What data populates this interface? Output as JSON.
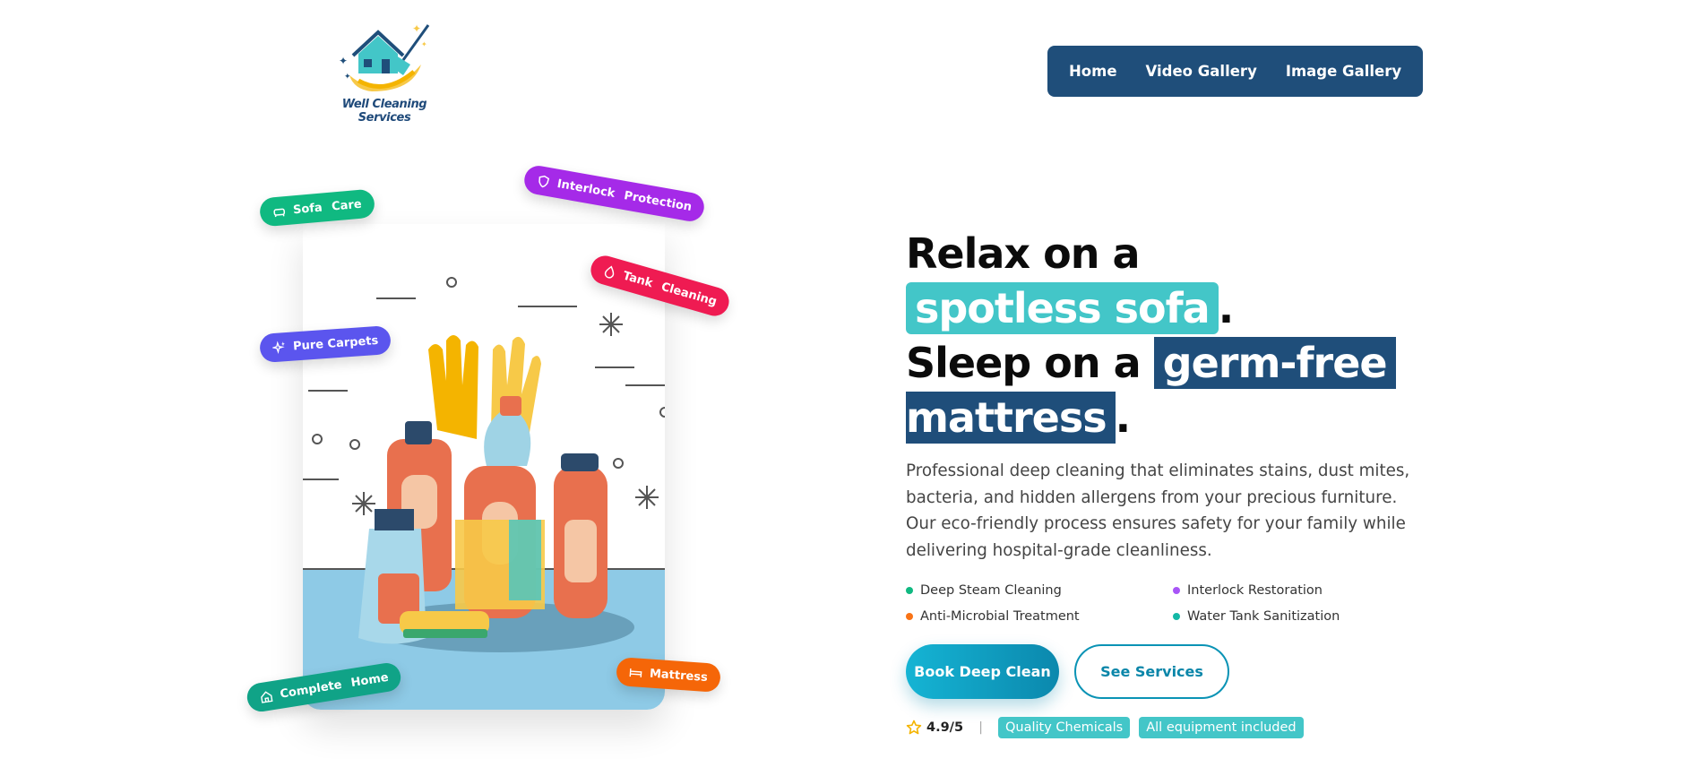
{
  "brand": {
    "name": "Well Cleaning Services",
    "logo_icon": "house-broom-logo"
  },
  "nav": {
    "items": [
      "Home",
      "Video Gallery",
      "Image Gallery"
    ]
  },
  "pills": {
    "sofa": "Sofa Care",
    "interlock": "Interlock Protection",
    "tank": "Tank Cleaning",
    "carpets": "Pure Carpets",
    "mattress": "Mattress",
    "home": "Complete Home"
  },
  "hero": {
    "line1_prefix": "Relax on a",
    "line1_highlight": "spotless sofa",
    "line1_suffix": ".",
    "line2_prefix": "Sleep on a",
    "line2_highlight_a": "germ-free",
    "line2_highlight_b": "mattress",
    "line2_suffix": ".",
    "description": "Professional deep cleaning that eliminates stains, dust mites, bacteria, and hidden allergens from your precious furniture. Our eco-friendly process ensures safety for your family while delivering hospital-grade cleanliness.",
    "features": [
      {
        "label": "Deep Steam Cleaning",
        "color": "#10b981"
      },
      {
        "label": "Interlock Restoration",
        "color": "#a855f7"
      },
      {
        "label": "Anti-Microbial Treatment",
        "color": "#f97316"
      },
      {
        "label": "Water Tank Sanitization",
        "color": "#14b8a6"
      }
    ],
    "primary_button": "Book Deep Clean",
    "secondary_button": "See Services",
    "rating": "4.9/5",
    "separator": "|",
    "tags": [
      "Quality Chemicals",
      "All equipment included"
    ]
  },
  "colors": {
    "navy": "#1f4e7a",
    "teal": "#43c6c8",
    "cyan": "#0b88ad"
  }
}
